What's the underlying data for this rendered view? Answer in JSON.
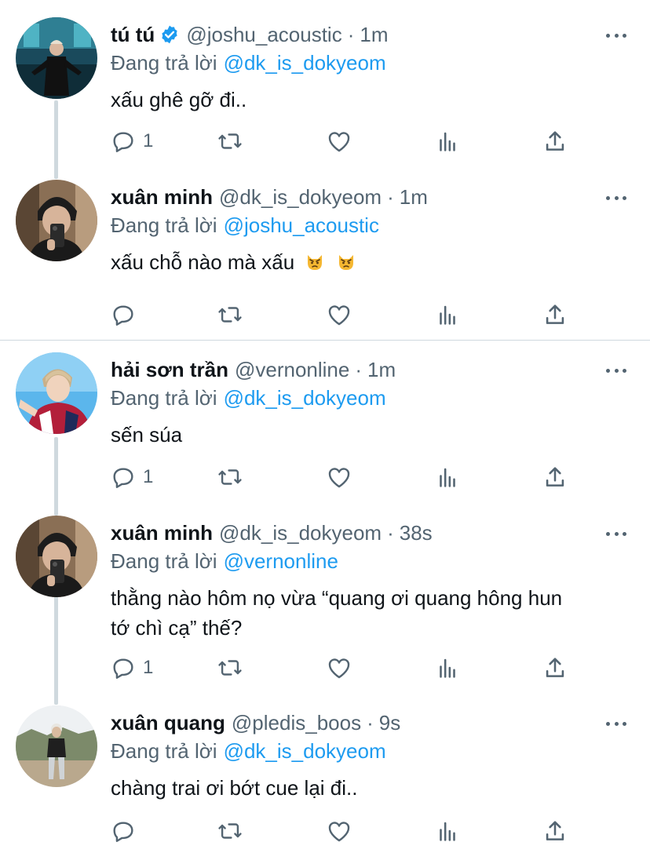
{
  "ui": {
    "reply_prefix": "Đang trả lời",
    "more_icon": "more-horizontal-icon",
    "action_icons": [
      "reply-icon",
      "retweet-icon",
      "like-icon",
      "analytics-icon",
      "share-icon"
    ]
  },
  "colors": {
    "name": "#0f1419",
    "secondary": "#536471",
    "accent": "#1d9bf0",
    "thread_line": "#cfd9de"
  },
  "tweets": [
    {
      "name": "tú tú",
      "verified": true,
      "handle": "@joshu_acoustic",
      "time": "1m",
      "reply_to": "@dk_is_dokyeom",
      "text": "xấu ghê gỡ đi..",
      "reply_count": "1"
    },
    {
      "name": "xuân minh",
      "handle": "@dk_is_dokyeom",
      "time": "1m",
      "reply_to": "@joshu_acoustic",
      "text": "xấu chỗ nào mà xấu",
      "emojis": [
        "pouting-cat-emoji",
        "pouting-cat-emoji"
      ],
      "reply_count": ""
    },
    {
      "name": "hải sơn trần",
      "handle": "@vernonline",
      "time": "1m",
      "reply_to": "@dk_is_dokyeom",
      "text": "sến súa",
      "reply_count": "1"
    },
    {
      "name": "xuân minh",
      "handle": "@dk_is_dokyeom",
      "time": "38s",
      "reply_to": "@vernonline",
      "text_line1": "thằng nào hôm nọ vừa “quang ơi quang hông hun",
      "text_line2": "tớ chì cạ” thế?",
      "reply_count": "1"
    },
    {
      "name": "xuân quang",
      "handle": "@pledis_boos",
      "time": "9s",
      "reply_to": "@dk_is_dokyeom",
      "text": "chàng trai ơi bớt cue lại đi..",
      "reply_count": ""
    }
  ]
}
